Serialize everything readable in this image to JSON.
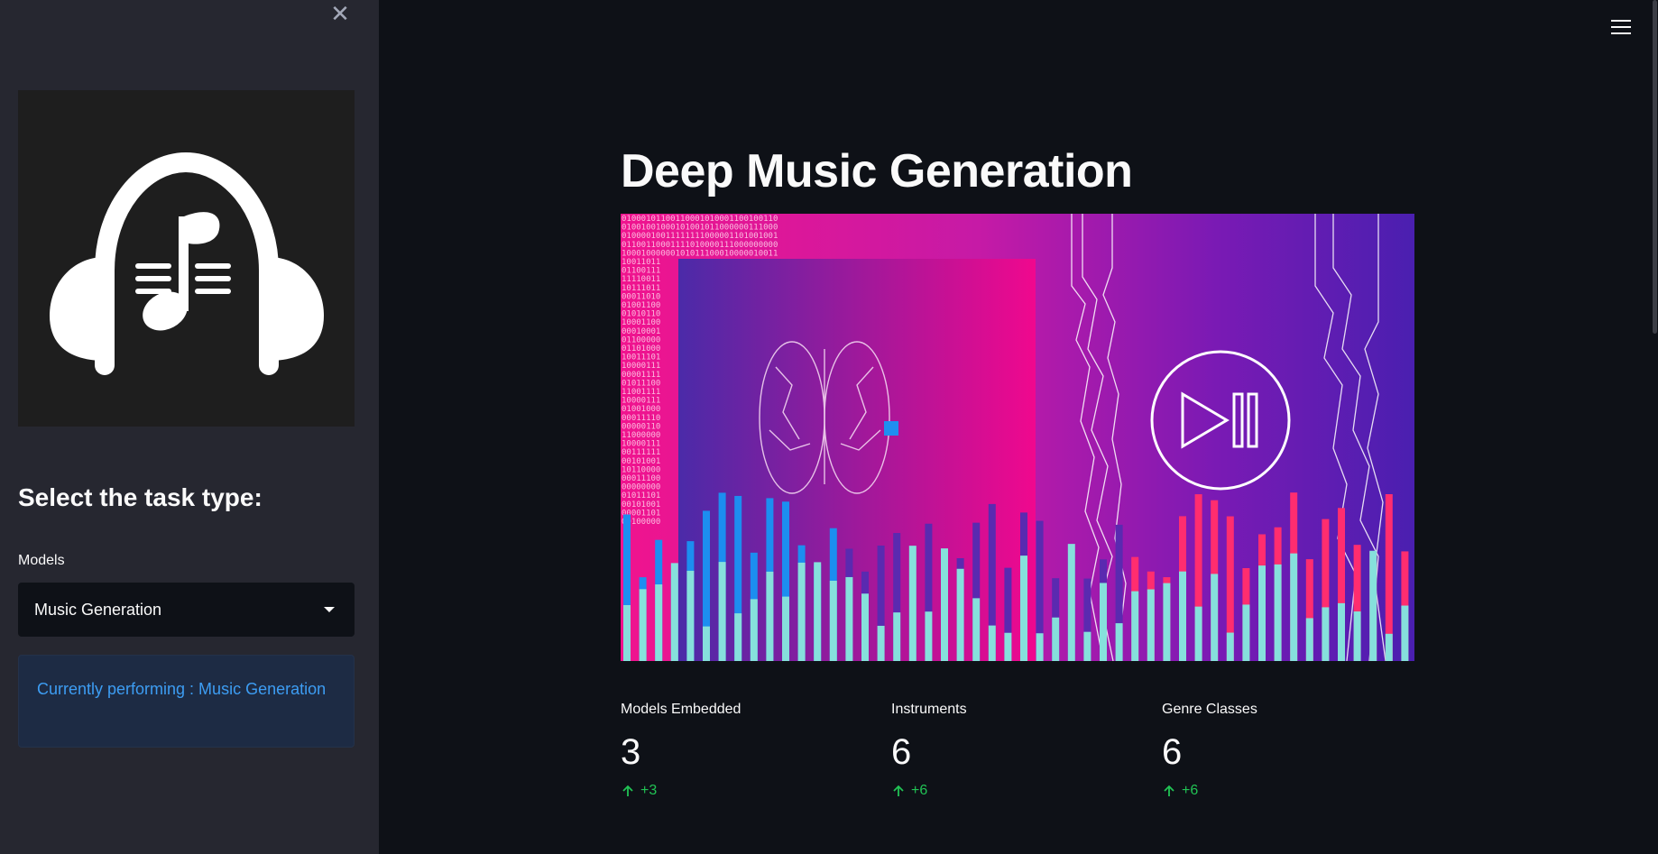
{
  "sidebar": {
    "heading": "Select the task type:",
    "select_label": "Models",
    "select_value": "Music Generation",
    "info_text": "Currently performing : Music Generation"
  },
  "main": {
    "title": "Deep Music Generation",
    "metrics": [
      {
        "label": "Models Embedded",
        "value": "3",
        "delta": "+3"
      },
      {
        "label": "Instruments",
        "value": "6",
        "delta": "+6"
      },
      {
        "label": "Genre Classes",
        "value": "6",
        "delta": "+6"
      }
    ]
  },
  "colors": {
    "accent_delta": "#21c354",
    "info_text": "#3d9df3",
    "sidebar_bg": "#262730",
    "main_bg": "#0e1117"
  },
  "icons": [
    "close-icon",
    "menu-icon",
    "headphones-music-icon",
    "chevron-down-icon",
    "arrow-up-icon"
  ]
}
